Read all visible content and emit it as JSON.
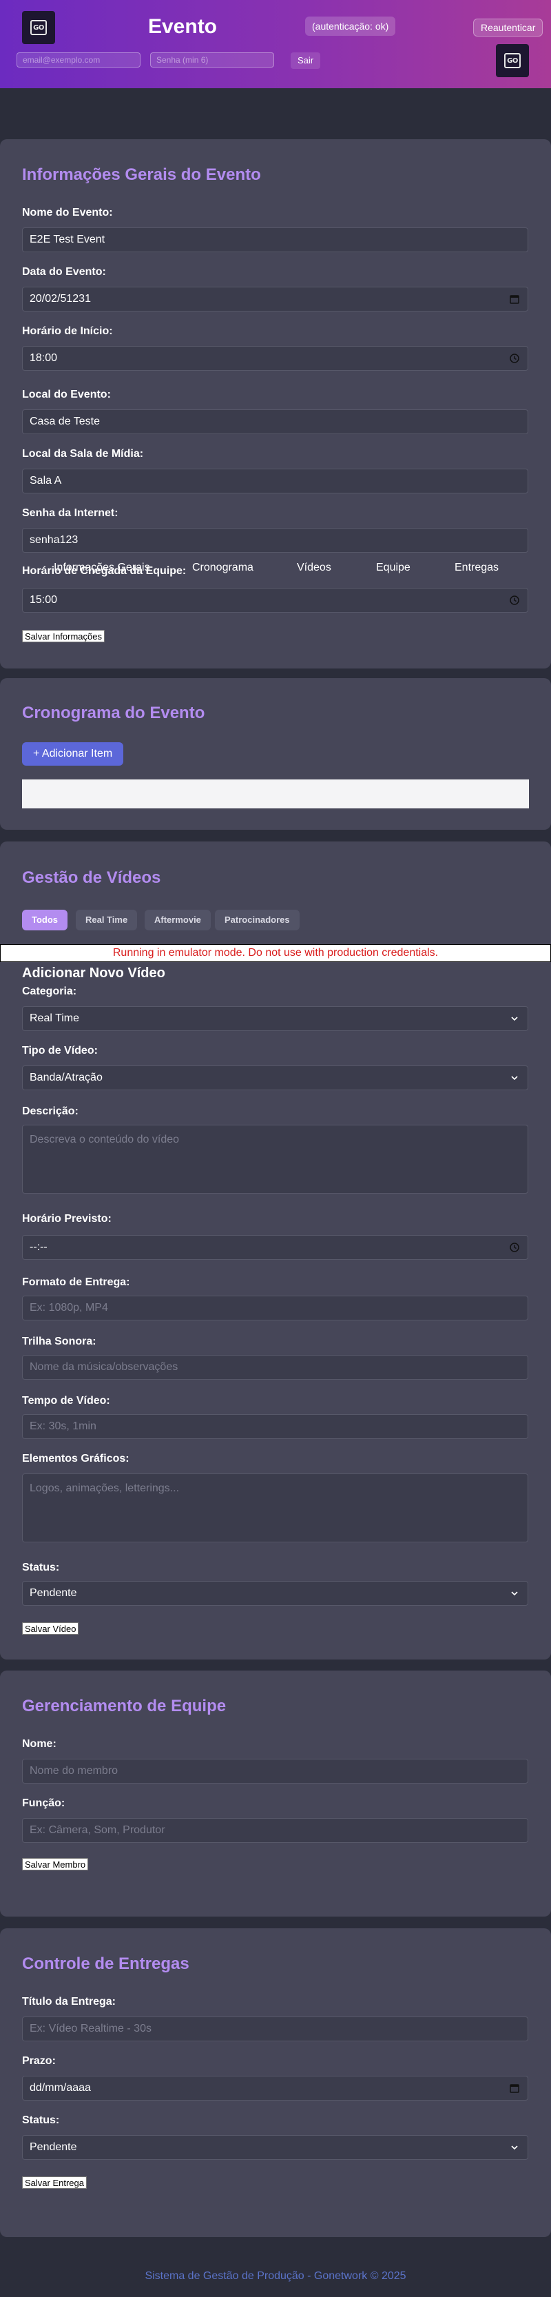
{
  "header": {
    "title": "Evento",
    "auth_status": "(autenticação: ok)",
    "reauth_label": "Reautenticar",
    "email_placeholder": "email@exemplo.com",
    "password_placeholder": "Senha (min 6)",
    "logout_label": "Sair",
    "logo_text": "GO"
  },
  "overlay_tabs": [
    "Informações Gerais",
    "Cronograma",
    "Vídeos",
    "Equipe",
    "Entregas"
  ],
  "general": {
    "title": "Informações Gerais do Evento",
    "fields": [
      {
        "label": "Nome do Evento:",
        "value": "E2E Test Event"
      },
      {
        "label": "Data do Evento:",
        "value": "20/02/51231"
      },
      {
        "label": "Horário de Início:",
        "value": "18:00"
      },
      {
        "label": "Local do Evento:",
        "value": "Casa de Teste"
      },
      {
        "label": "Local da Sala de Mídia:",
        "value": "Sala A"
      },
      {
        "label": "Senha da Internet:",
        "value": "senha123"
      },
      {
        "label": "Horário de Chegada da Equipe:",
        "value": "15:00"
      }
    ],
    "save_label": "Salvar Informações"
  },
  "schedule": {
    "title": "Cronograma do Evento",
    "add_label": "+ Adicionar Item"
  },
  "videos": {
    "title": "Gestão de Vídeos",
    "filters": [
      "Todos",
      "Real Time",
      "Aftermovie",
      "Patrocinadores"
    ],
    "active_filter": "Todos",
    "emulator_notice": "Running in emulator mode. Do not use with production credentials.",
    "form_title": "Adicionar Novo Vídeo",
    "category_label": "Categoria:",
    "category_value": "Real Time",
    "type_label": "Tipo de Vídeo:",
    "type_value": "Banda/Atração",
    "description_label": "Descrição:",
    "description_placeholder": "Descreva o conteúdo do vídeo",
    "time_label": "Horário Previsto:",
    "time_value": "--:--",
    "format_label": "Formato de Entrega:",
    "format_placeholder": "Ex: 1080p, MP4",
    "soundtrack_label": "Trilha Sonora:",
    "soundtrack_placeholder": "Nome da música/observações",
    "duration_label": "Tempo de Vídeo:",
    "duration_placeholder": "Ex: 30s, 1min",
    "graphics_label": "Elementos Gráficos:",
    "graphics_placeholder": "Logos, animações, letterings...",
    "status_label": "Status:",
    "status_value": "Pendente",
    "save_label": "Salvar Vídeo"
  },
  "team": {
    "title": "Gerenciamento de Equipe",
    "name_label": "Nome:",
    "name_placeholder": "Nome do membro",
    "role_label": "Função:",
    "role_placeholder": "Ex: Câmera, Som, Produtor",
    "save_label": "Salvar Membro"
  },
  "deliveries": {
    "title": "Controle de Entregas",
    "title_label": "Título da Entrega:",
    "title_placeholder": "Ex: Vídeo Realtime - 30s",
    "deadline_label": "Prazo:",
    "deadline_value": "dd/mm/aaaa",
    "status_label": "Status:",
    "status_value": "Pendente",
    "save_label": "Salvar Entrega"
  },
  "footer": {
    "text": "Sistema de Gestão de Produção - Gonetwork © 2025"
  },
  "colors": {
    "accent": "#b38cf0",
    "card_bg": "#464658",
    "page_bg": "#2b2d3a",
    "primary_button": "#5c67d9",
    "warning_text": "#d91c1c"
  }
}
